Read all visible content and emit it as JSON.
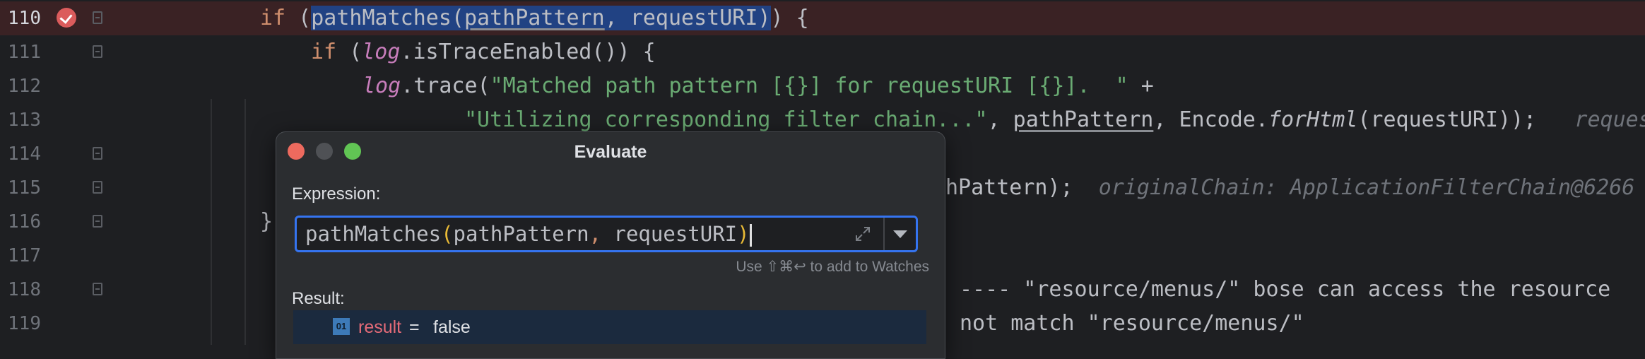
{
  "editor": {
    "lines": [
      {
        "num": "110",
        "current": true
      },
      {
        "num": "111"
      },
      {
        "num": "112"
      },
      {
        "num": "113"
      },
      {
        "num": "114"
      },
      {
        "num": "115"
      },
      {
        "num": "116"
      },
      {
        "num": "117"
      },
      {
        "num": "118"
      },
      {
        "num": "119"
      }
    ],
    "l110": {
      "kw_if": "if",
      "open": " (",
      "fn": "pathMatches(",
      "arg1": "pathPattern",
      "sep": ", ",
      "arg2": "requestURI",
      "close_sel": ")",
      "rest": ") {"
    },
    "l111": {
      "kw_if": "if",
      "pre": " (",
      "obj": "log",
      "rest": ".isTraceEnabled()) {"
    },
    "l112": {
      "obj": "log",
      "mid": ".trace(",
      "str": "\"Matched path pattern [{}] for requestURI [{}].  \"",
      "rest": " +"
    },
    "l113": {
      "str": "\"Utilizing corresponding filter chain...\"",
      "sep": ", ",
      "arg": "pathPattern",
      "mid": ", Encode.",
      "method": "forHtml",
      "rest": "(requestURI));",
      "hint": "request"
    },
    "l115": {
      "visible": "hPattern);",
      "hint": "originalChain: ApplicationFilterChain@6266"
    },
    "l116": {
      "brace": "}"
    },
    "l118": {
      "comment": "---- \"resource/menus/\" bose can access the resource"
    },
    "l119": {
      "comment": "not match \"resource/menus/\""
    }
  },
  "dialog": {
    "title": "Evaluate",
    "expression_label": "Expression:",
    "expression": {
      "fn": "pathMatches",
      "open": "(",
      "arg1": "pathPattern",
      "comma": ", ",
      "arg2": "requestURI",
      "close": ")"
    },
    "watch_hint": "Use ⇧⌘↩ to add to Watches",
    "result_label": "Result:",
    "result": {
      "icon_text": "01",
      "name": "result",
      "eq": " = ",
      "value": "false"
    }
  },
  "icons": [
    "breakpoint-check-icon",
    "fold-marker-icon",
    "expand-icon",
    "dropdown-arrow-icon",
    "primitive-type-icon"
  ],
  "colors": {
    "breakpoint": "#db5c5c",
    "selection": "#214283",
    "focus": "#3574f0",
    "string": "#6aab73",
    "keyword": "#cf8e6d"
  }
}
